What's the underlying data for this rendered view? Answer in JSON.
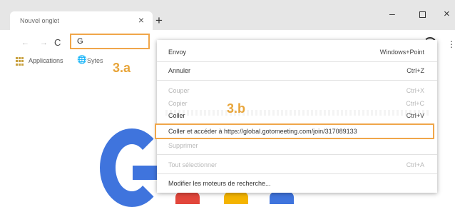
{
  "tab": {
    "title": "Nouvel onglet"
  },
  "omnibox": {
    "value": "G"
  },
  "bookmarks": {
    "apps_label": "Applications",
    "site_label": "Sytes"
  },
  "annotations": {
    "a": "3.a",
    "b": "3.b"
  },
  "menu": {
    "undo_top": {
      "label": "Envoy",
      "shortcut": "Windows+Point"
    },
    "undo": {
      "label": "Annuler",
      "shortcut": "Ctrl+Z"
    },
    "cut": {
      "label": "Couper",
      "shortcut": "Ctrl+X"
    },
    "copy": {
      "label": "Copier",
      "shortcut": "Ctrl+C"
    },
    "paste": {
      "label": "Coller",
      "shortcut": "Ctrl+V"
    },
    "paste_go": {
      "label": "Coller et accéder à https://global.gotomeeting.com/join/317089133"
    },
    "delete": {
      "label": "Supprimer"
    },
    "select_all": {
      "label": "Tout sélectionner",
      "shortcut": "Ctrl+A"
    },
    "edit_engines": {
      "label": "Modifier les moteurs de recherche..."
    }
  },
  "colors": {
    "annotation": "#e8a53a",
    "highlight_border": "#f0a64a",
    "google_blue": "#3f74dd"
  }
}
